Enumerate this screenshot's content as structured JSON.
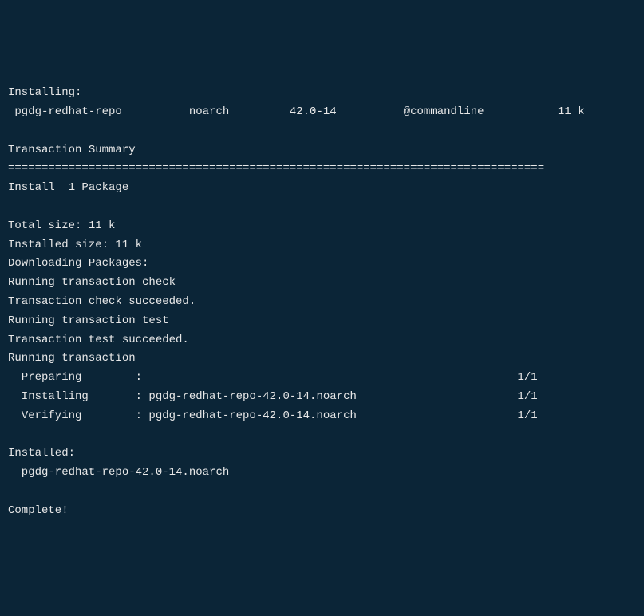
{
  "installing_header": "Installing:",
  "package_row": " pgdg-redhat-repo          noarch         42.0-14          @commandline           11 k",
  "blank": "",
  "transaction_summary_header": "Transaction Summary",
  "separator": "================================================================================",
  "install_count": "Install  1 Package",
  "total_size": "Total size: 11 k",
  "installed_size": "Installed size: 11 k",
  "downloading": "Downloading Packages:",
  "running_check": "Running transaction check",
  "check_succeeded": "Transaction check succeeded.",
  "running_test": "Running transaction test",
  "test_succeeded": "Transaction test succeeded.",
  "running_transaction": "Running transaction",
  "preparing": "  Preparing        :                                                        1/1",
  "installing": "  Installing       : pgdg-redhat-repo-42.0-14.noarch                        1/1",
  "verifying": "  Verifying        : pgdg-redhat-repo-42.0-14.noarch                        1/1",
  "installed_header": "Installed:",
  "installed_package": "  pgdg-redhat-repo-42.0-14.noarch",
  "complete": "Complete!"
}
